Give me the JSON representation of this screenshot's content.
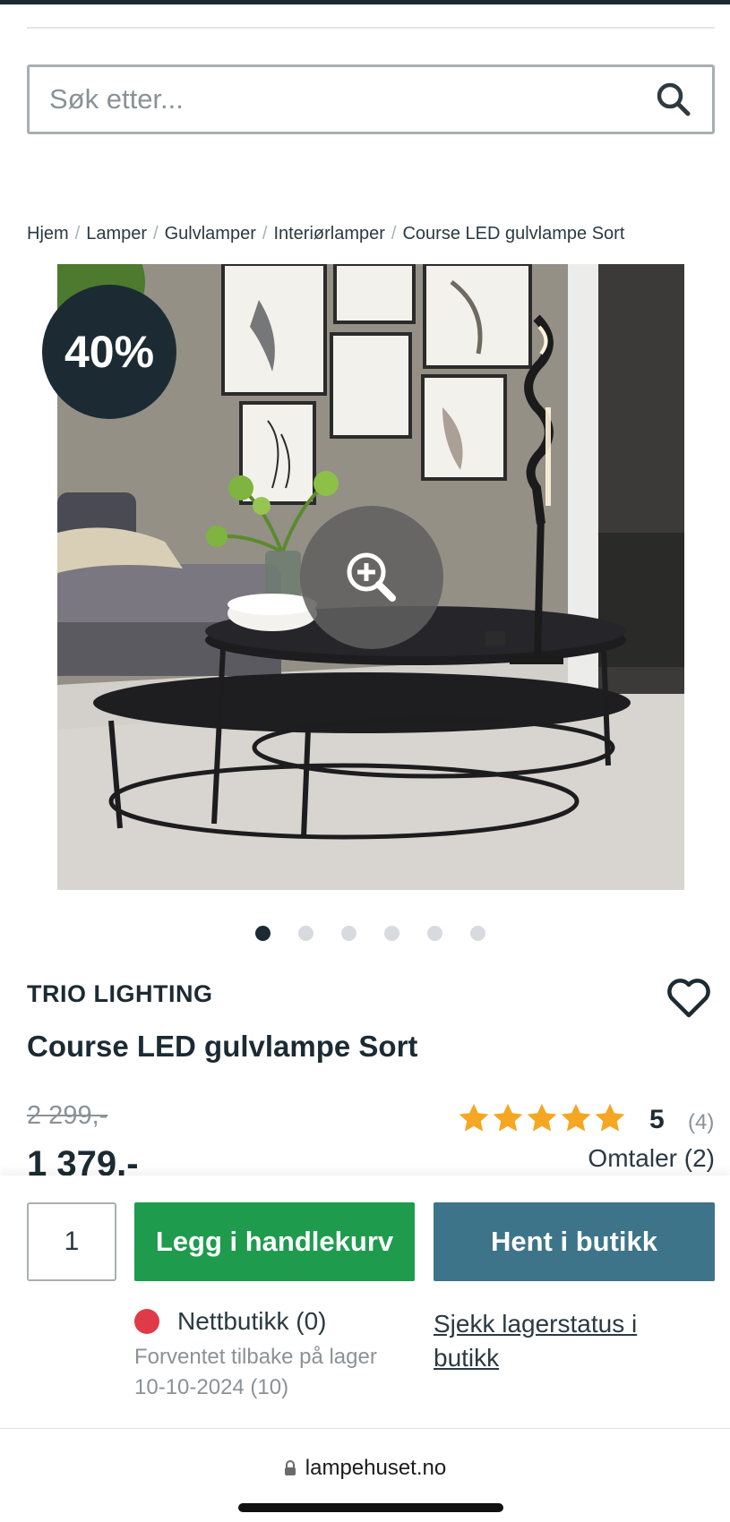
{
  "search": {
    "placeholder": "Søk etter..."
  },
  "breadcrumb": [
    "Hjem",
    "Lamper",
    "Gulvlamper",
    "Interiørlamper",
    "Course LED gulvlampe Sort"
  ],
  "product": {
    "discount_badge": "40%",
    "brand": "TRIO LIGHTING",
    "title": "Course LED gulvlampe Sort",
    "old_price": "2 299,-",
    "new_price": "1 379.-",
    "rating": {
      "value": "5",
      "count": "(4)",
      "stars": 5
    },
    "reviews_link": "Omtaler (2)",
    "gallery": {
      "total": 6,
      "active_index": 0
    }
  },
  "buy": {
    "quantity": "1",
    "add_to_cart_label": "Legg i handlekurv",
    "pickup_label": "Hent i butikk",
    "stock_label": "Nettbutikk (0)",
    "stock_status_color": "#e03a48",
    "expected_line1": "Forventet tilbake på lager",
    "expected_line2": "10-10-2024 (10)",
    "check_stock_label": "Sjekk lagerstatus i butikk"
  },
  "browser": {
    "url": "lampehuset.no"
  },
  "colors": {
    "brand_dark": "#1c2b33",
    "cart_green": "#1e9b4d",
    "store_teal": "#3d7489",
    "star": "#f5a623"
  }
}
